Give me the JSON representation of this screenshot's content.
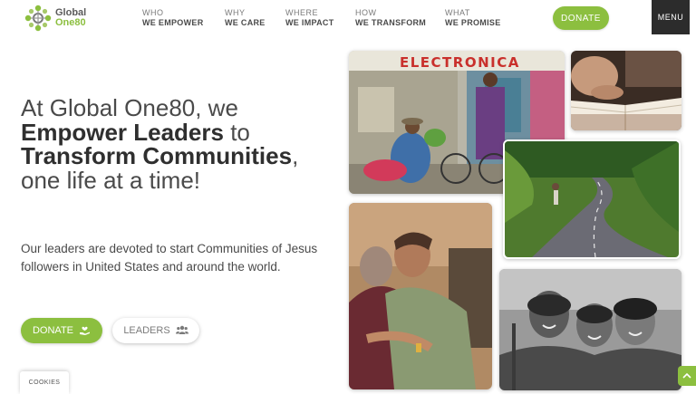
{
  "header": {
    "logo_line1": "Global",
    "logo_line2": "One80",
    "nav": [
      {
        "small": "WHO",
        "big": "WE EMPOWER"
      },
      {
        "small": "WHY",
        "big": "WE CARE"
      },
      {
        "small": "WHERE",
        "big": "WE IMPACT"
      },
      {
        "small": "HOW",
        "big": "WE TRANSFORM"
      },
      {
        "small": "WHAT",
        "big": "WE PROMISE"
      }
    ],
    "donate_label": "DONATE",
    "menu_label": "MENU"
  },
  "hero": {
    "headline_part1": "At Global One80, we ",
    "headline_bold1": "Empower Leaders",
    "headline_part2": " to ",
    "headline_bold2": "Transform Communities",
    "headline_part3": ", one life at a time!",
    "subtext": "Our leaders are devoted to start Communities of Jesus followers in United States and around the world.",
    "donate_label": "DONATE",
    "leaders_label": "LEADERS"
  },
  "photos": {
    "street_sign": "ELECTRONICA"
  },
  "cookies_label": "COOKIES",
  "colors": {
    "accent": "#8cbf3f",
    "menu_bg": "#2c2c2c",
    "text": "#4a4a4a"
  },
  "icons": [
    "logo-mark-icon",
    "hand-heart-icon",
    "people-group-icon",
    "chevron-up-icon"
  ]
}
